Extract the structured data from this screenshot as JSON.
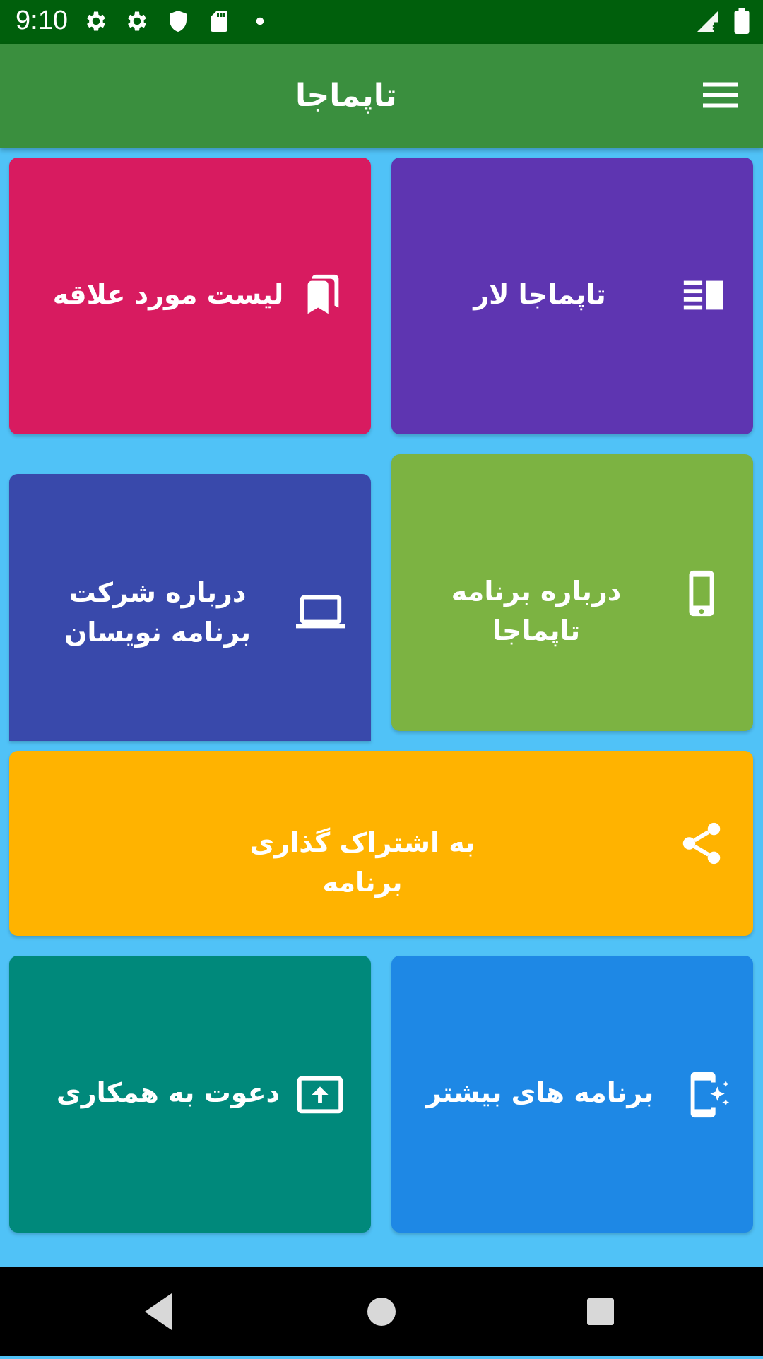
{
  "status_bar": {
    "time": "9:10",
    "icons_left": [
      "gear-icon",
      "gear-icon",
      "shield-icon",
      "sd-card-icon",
      "dot-icon"
    ],
    "icons_right": [
      "signal-icon",
      "battery-icon"
    ]
  },
  "app_bar": {
    "title": "تاپماجا",
    "menu_icon": "hamburger-menu-icon"
  },
  "tiles": {
    "tapmaja_lar": {
      "label": "تاپماجا لار",
      "icon": "list-view-icon",
      "color": "#5e35b1"
    },
    "favorites": {
      "label": "لیست مورد علاقه",
      "icon": "bookmarks-icon",
      "color": "#d81b60"
    },
    "about_app": {
      "label": "درباره برنامه تاپماجا",
      "icon": "phone-icon",
      "color": "#7cb342"
    },
    "about_company": {
      "label": "درباره شرکت برنامه نویسان",
      "icon": "laptop-icon",
      "color": "#3949ab"
    },
    "share": {
      "label": "به اشتراک گذاری برنامه",
      "icon": "share-icon",
      "color": "#ffb300"
    },
    "more_apps": {
      "label": "برنامه های بیشتر",
      "icon": "app-sparkle-icon",
      "color": "#1e88e5"
    },
    "invite": {
      "label": "دعوت به همکاری",
      "icon": "upload-screen-icon",
      "color": "#00897b"
    }
  },
  "nav_bar": {
    "back_icon": "back-triangle-icon",
    "home_icon": "home-circle-icon",
    "recents_icon": "recents-square-icon"
  },
  "colors": {
    "status_bar": "#005f0c",
    "app_bar": "#3a8f3e",
    "background": "#50c2f7"
  }
}
